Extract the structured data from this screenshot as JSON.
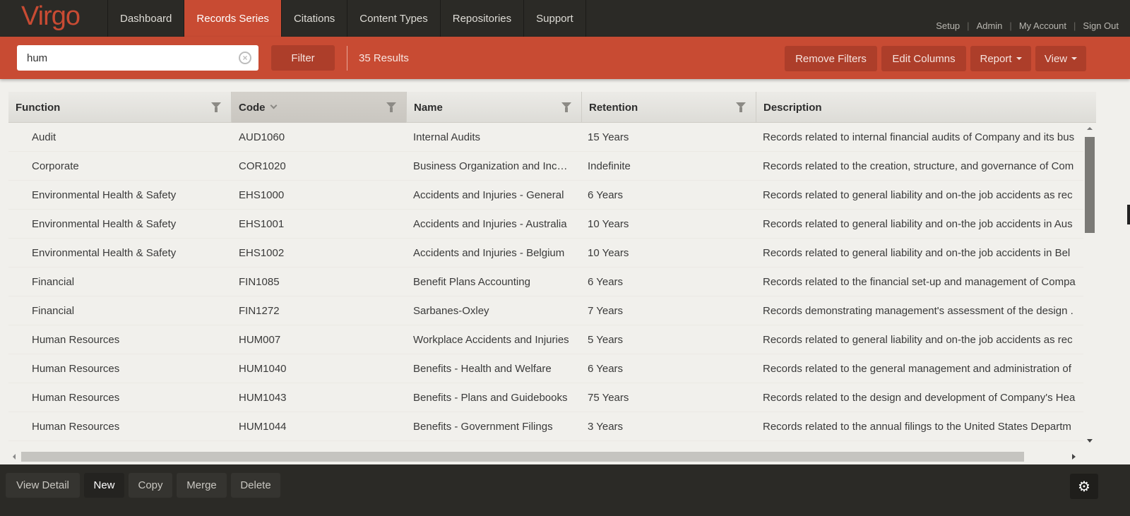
{
  "app": {
    "logo": "Virgo"
  },
  "nav": {
    "tabs": [
      {
        "label": "Dashboard",
        "active": false
      },
      {
        "label": "Records Series",
        "active": true
      },
      {
        "label": "Citations",
        "active": false
      },
      {
        "label": "Content Types",
        "active": false
      },
      {
        "label": "Repositories",
        "active": false
      },
      {
        "label": "Support",
        "active": false
      }
    ],
    "utility_links": [
      "Setup",
      "Admin",
      "My Account",
      "Sign Out"
    ]
  },
  "filterbar": {
    "search_value": "hum",
    "clear_icon": "clear-circle-icon",
    "filter_label": "Filter",
    "results": "35 Results",
    "remove_filters_label": "Remove Filters",
    "edit_columns_label": "Edit Columns",
    "report_label": "Report",
    "view_label": "View"
  },
  "grid": {
    "columns": [
      {
        "label": "Function",
        "filter_icon": "funnel-icon"
      },
      {
        "label": "Code",
        "sorted": "descending",
        "filter_icon": "funnel-icon"
      },
      {
        "label": "Name",
        "filter_icon": "funnel-icon"
      },
      {
        "label": "Retention",
        "filter_icon": "funnel-icon"
      },
      {
        "label": "Description"
      }
    ],
    "rows": [
      {
        "function": "Audit",
        "code": "AUD1060",
        "name": "Internal Audits",
        "retention": "15 Years",
        "description": "Records related to internal financial audits of Company and its bus"
      },
      {
        "function": "Corporate",
        "code": "COR1020",
        "name": "Business Organization and Inc…",
        "retention": "Indefinite",
        "description": "Records related to the creation, structure, and governance of Com"
      },
      {
        "function": "Environmental Health & Safety",
        "code": "EHS1000",
        "name": "Accidents and Injuries - General",
        "retention": "6 Years",
        "description": "Records related to general liability and on-the job accidents as rec"
      },
      {
        "function": "Environmental Health & Safety",
        "code": "EHS1001",
        "name": "Accidents and Injuries - Australia",
        "retention": "10 Years",
        "description": "Records related to general liability and on-the job accidents in Aus"
      },
      {
        "function": "Environmental Health & Safety",
        "code": "EHS1002",
        "name": "Accidents and Injuries - Belgium",
        "retention": "10 Years",
        "description": "Records related to general liability and on-the job accidents in Bel"
      },
      {
        "function": "Financial",
        "code": "FIN1085",
        "name": "Benefit Plans Accounting",
        "retention": "6 Years",
        "description": "Records related to the financial set-up and management of Compa"
      },
      {
        "function": "Financial",
        "code": "FIN1272",
        "name": "Sarbanes-Oxley",
        "retention": "7 Years",
        "description": "Records demonstrating management's assessment of the design ."
      },
      {
        "function": "Human Resources",
        "code": "HUM007",
        "name": "Workplace Accidents and Injuries",
        "retention": "5 Years",
        "description": "Records related to general liability and on-the job accidents as rec"
      },
      {
        "function": "Human Resources",
        "code": "HUM1040",
        "name": "Benefits - Health and Welfare",
        "retention": "6 Years",
        "description": "Records related to the general management and administration of"
      },
      {
        "function": "Human Resources",
        "code": "HUM1043",
        "name": "Benefits - Plans and Guidebooks",
        "retention": "75 Years",
        "description": "Records related to the design and development of Company's Hea"
      },
      {
        "function": "Human Resources",
        "code": "HUM1044",
        "name": "Benefits - Government Filings",
        "retention": "3 Years",
        "description": "Records related to the annual filings to the United States Departm"
      }
    ]
  },
  "bottombar": {
    "buttons": [
      "View Detail",
      "New",
      "Copy",
      "Merge",
      "Delete"
    ],
    "settings_icon": "gear-icon"
  },
  "colors": {
    "brand": "#c84b33",
    "nav_bg": "#2b2a26",
    "button_dark_red": "#ad3e2a",
    "grid_bg": "#f1f0ec"
  }
}
